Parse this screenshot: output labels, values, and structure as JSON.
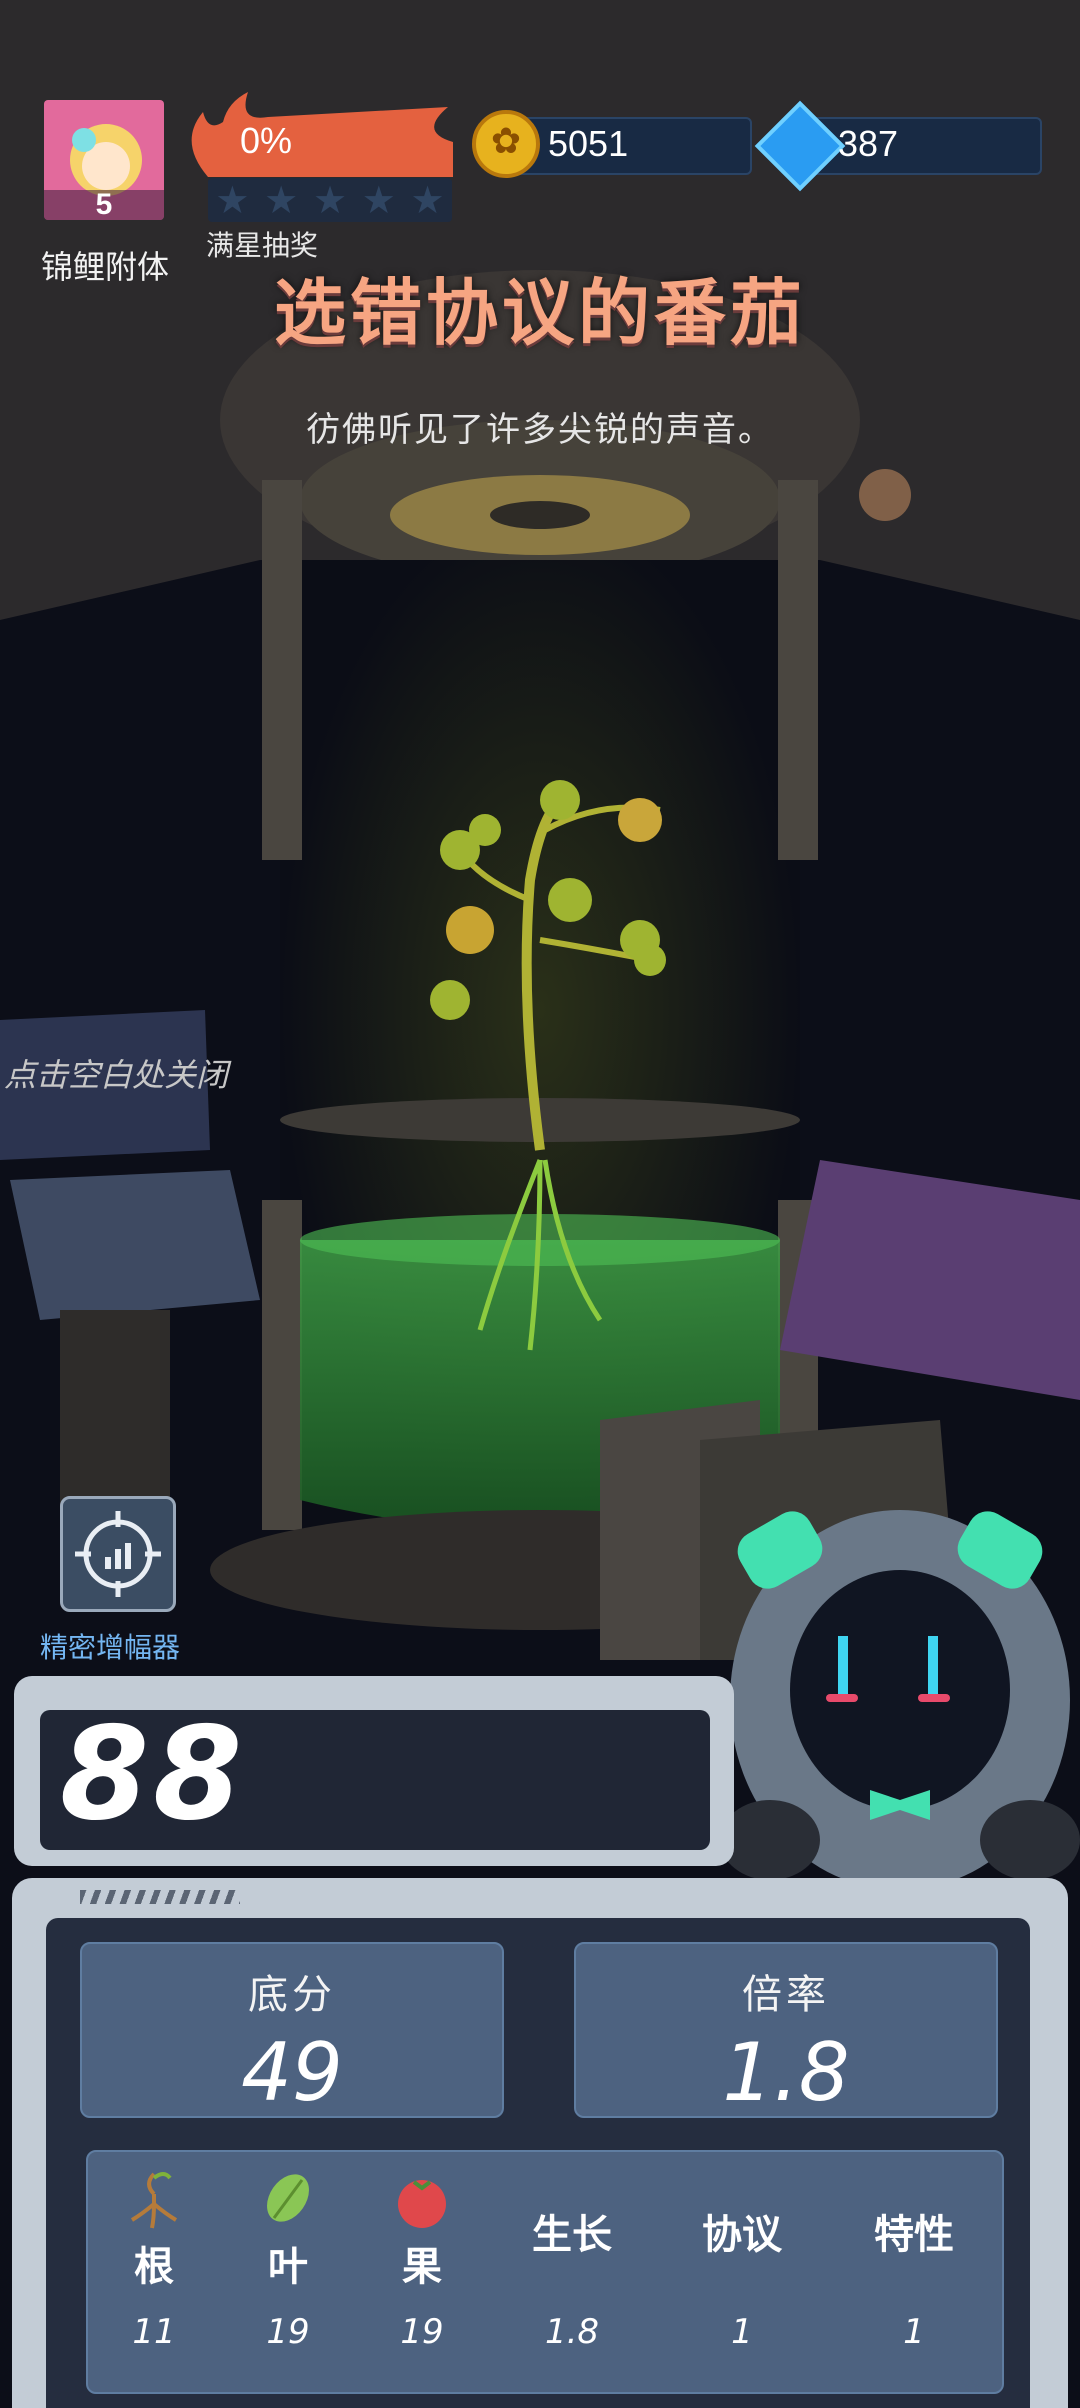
{
  "hud": {
    "avatar": {
      "level": "5",
      "label": "锦鲤附体"
    },
    "star_draw": {
      "progress_text": "0%",
      "progress": 0,
      "stars_filled": 0,
      "stars_total": 5,
      "label": "满星抽奖"
    },
    "gold": {
      "icon": "gold-coin-icon",
      "value": "5051"
    },
    "gem": {
      "icon": "blue-gem-icon",
      "value": "387"
    }
  },
  "title": "选错协议的番茄",
  "subtitle": "彷佛听见了许多尖锐的声音。",
  "close_hint": "点击空白处关闭",
  "amplifier": {
    "icon": "target-chart-icon",
    "label": "精密增幅器"
  },
  "score": {
    "total": "88"
  },
  "stats": {
    "base": {
      "label": "底分",
      "value": "49"
    },
    "multiplier": {
      "label": "倍率",
      "value": "1.8"
    }
  },
  "attributes": [
    {
      "label": "根",
      "icon": "root-icon",
      "value": "11"
    },
    {
      "label": "叶",
      "icon": "leaf-icon",
      "value": "19"
    },
    {
      "label": "果",
      "icon": "tomato-icon",
      "value": "19"
    },
    {
      "label": "生长",
      "value": "1.8"
    },
    {
      "label": "协议",
      "value": "1"
    },
    {
      "label": "特性",
      "value": "1"
    }
  ],
  "colors": {
    "title": "#f6a582",
    "panel": "#c3ccd6",
    "panel_inner": "#252d3f",
    "stat_box": "#4d6280",
    "accent_blue": "#74b6f2",
    "fire": "#e4613f"
  }
}
